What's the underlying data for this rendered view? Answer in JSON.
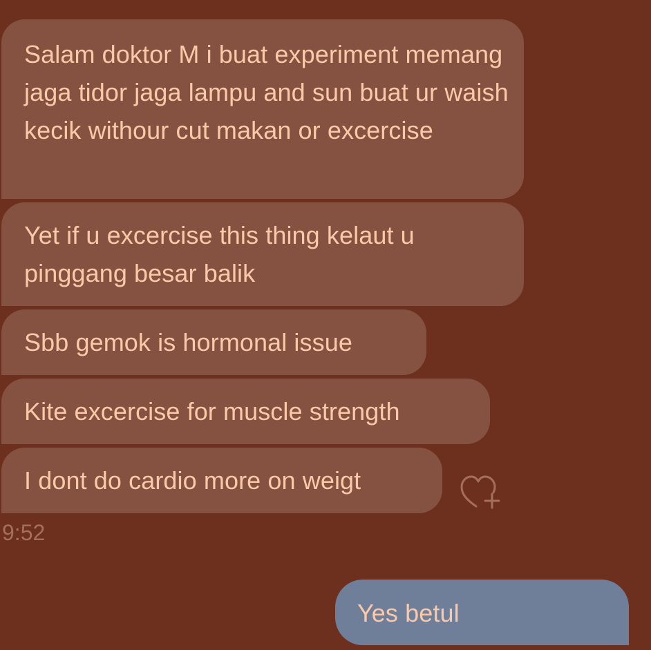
{
  "messages": {
    "received": [
      "Salam doktor M i buat experiment memang jaga tidor jaga lampu and sun buat ur waish kecik withour cut makan or excercise",
      "Yet if u excercise this thing kelaut u pinggang besar balik",
      "Sbb gemok is hormonal issue",
      "Kite excercise for muscle strength",
      "I dont do cardio more on weigt"
    ],
    "timestamp": "9:52",
    "sent": [
      "Yes betul"
    ]
  },
  "icons": {
    "react": "heart-plus-icon"
  },
  "colors": {
    "background": "#6e301e",
    "received_bubble": "#855242",
    "sent_bubble": "#6f7f99",
    "text": "#fbc9a8",
    "timestamp": "#a56f5e"
  }
}
